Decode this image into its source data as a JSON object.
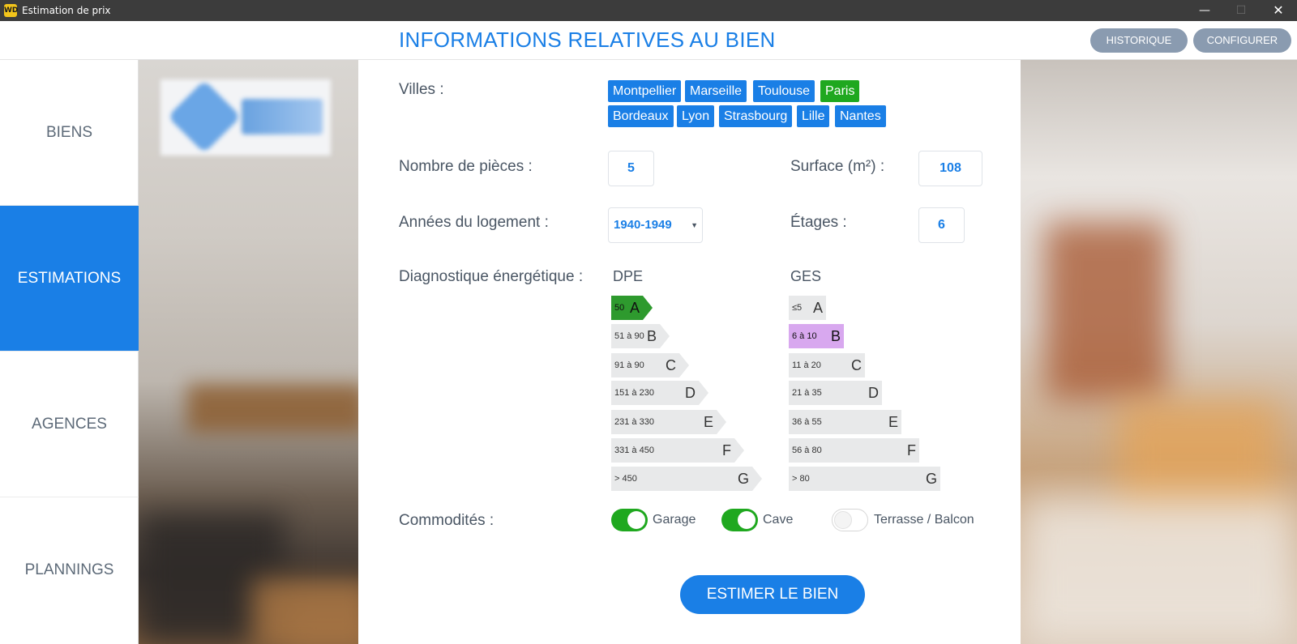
{
  "window": {
    "title": "Estimation de prix",
    "min_glyph": "—",
    "max_glyph": "☐",
    "close_glyph": "✕",
    "app_icon_label": "WD"
  },
  "header": {
    "title": "INFORMATIONS RELATIVES AU BIEN",
    "buttons": {
      "historique": "HISTORIQUE",
      "configurer": "CONFIGURER"
    }
  },
  "sidebar": {
    "items": [
      {
        "label": "BIENS",
        "active": false
      },
      {
        "label": "ESTIMATIONS",
        "active": true
      },
      {
        "label": "AGENCES",
        "active": false
      },
      {
        "label": "PLANNINGS",
        "active": false
      }
    ]
  },
  "form": {
    "villes": {
      "label": "Villes  :",
      "options": [
        "Montpellier",
        "Marseille",
        "Toulouse",
        "Paris",
        "Bordeaux",
        "Lyon",
        "Strasbourg",
        "Lille",
        "Nantes"
      ],
      "selected": "Paris"
    },
    "pieces": {
      "label": "Nombre de pièces :",
      "value": "5"
    },
    "surface": {
      "label": "Surface (m²) :",
      "value": "108"
    },
    "annees": {
      "label": "Années du logement :",
      "value": "1940-1949"
    },
    "etages": {
      "label": "Étages :",
      "value": "6"
    },
    "diagnostic": {
      "label": "Diagnostique énergétique :",
      "dpe": {
        "title": "DPE",
        "selected": "A",
        "rows": [
          {
            "range": "50",
            "letter": "A"
          },
          {
            "range": "51 à 90",
            "letter": "B"
          },
          {
            "range": "91 à 90",
            "letter": "C"
          },
          {
            "range": "151 à 230",
            "letter": "D"
          },
          {
            "range": "231 à 330",
            "letter": "E"
          },
          {
            "range": "331 à 450",
            "letter": "F"
          },
          {
            "range": "> 450",
            "letter": "G"
          }
        ]
      },
      "ges": {
        "title": "GES",
        "selected": "B",
        "rows": [
          {
            "range": "≤5",
            "letter": "A"
          },
          {
            "range": "6 à 10",
            "letter": "B"
          },
          {
            "range": "11 à 20",
            "letter": "C"
          },
          {
            "range": "21 à 35",
            "letter": "D"
          },
          {
            "range": "36 à 55",
            "letter": "E"
          },
          {
            "range": "56 à 80",
            "letter": "F"
          },
          {
            "range": "> 80",
            "letter": "G"
          }
        ]
      }
    },
    "commodites": {
      "label": "Commodités :",
      "items": [
        {
          "label": "Garage",
          "on": true
        },
        {
          "label": "Cave",
          "on": true
        },
        {
          "label": "Terrasse / Balcon",
          "on": false
        }
      ]
    },
    "submit": "ESTIMER LE BIEN"
  },
  "colors": {
    "accent": "#1a7fe6",
    "selected_city": "#1fa81f",
    "dpe_selected": "#2e9a2e",
    "ges_selected": "#d8a8ef",
    "header_button": "#8a9bb0",
    "titlebar": "#3c3c3c"
  }
}
